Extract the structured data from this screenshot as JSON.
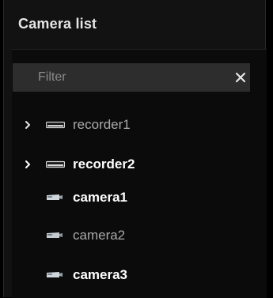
{
  "panel": {
    "title": "Camera list",
    "filter": {
      "placeholder": "Filter",
      "value": "",
      "clear_icon": "close-icon"
    }
  },
  "tree": {
    "items": [
      {
        "label": "recorder1",
        "type": "recorder",
        "expandable": true,
        "bold": false,
        "icon": "recorder-icon"
      },
      {
        "label": "recorder2",
        "type": "recorder",
        "expandable": true,
        "bold": true,
        "icon": "recorder-icon"
      },
      {
        "label": "camera1",
        "type": "camera",
        "expandable": false,
        "bold": true,
        "icon": "camera-icon"
      },
      {
        "label": "camera2",
        "type": "camera",
        "expandable": false,
        "bold": false,
        "icon": "camera-icon"
      },
      {
        "label": "camera3",
        "type": "camera",
        "expandable": false,
        "bold": true,
        "icon": "camera-icon"
      }
    ]
  },
  "colors": {
    "background": "#121212",
    "filter_background": "#2d2d2d",
    "text_bold": "#ffffff",
    "text_normal": "#a9a9a9"
  }
}
